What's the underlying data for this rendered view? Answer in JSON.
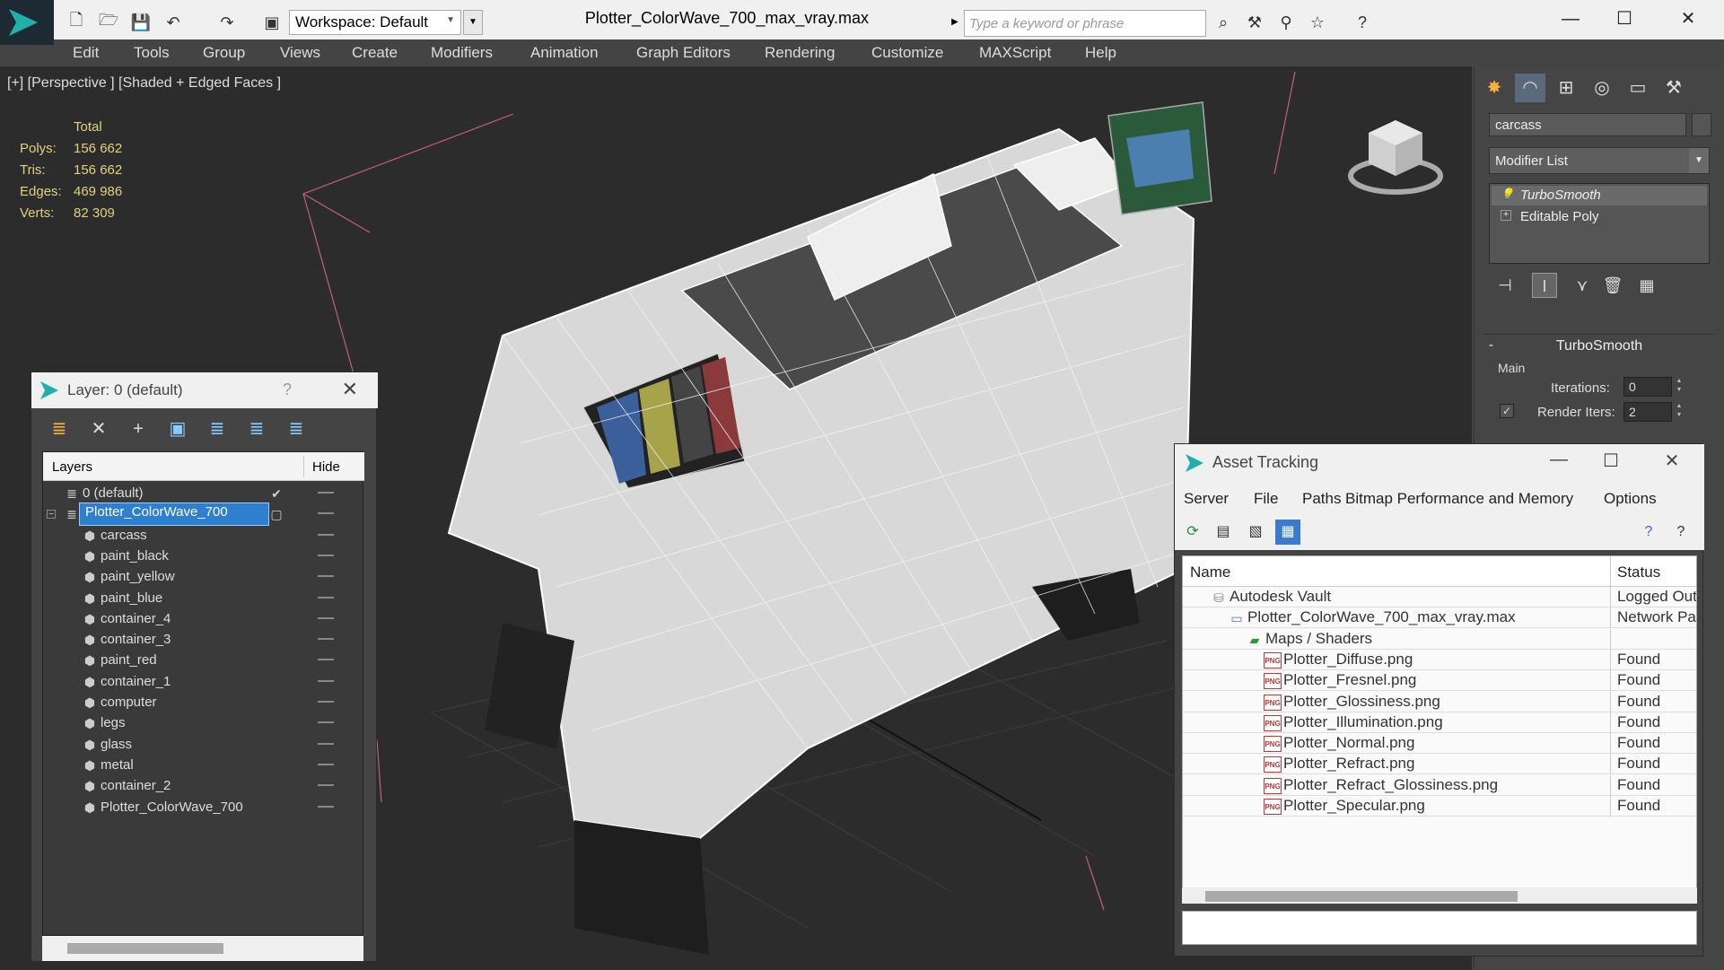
{
  "window": {
    "title": "Plotter_ColorWave_700_max_vray.max",
    "workspace_label": "Workspace: Default",
    "search_placeholder": "Type a keyword or phrase",
    "minimize": "—",
    "maximize": "☐",
    "close": "✕"
  },
  "menubar": {
    "items": [
      "Edit",
      "Tools",
      "Group",
      "Views",
      "Create",
      "Modifiers",
      "Animation",
      "Graph Editors",
      "Rendering",
      "Customize",
      "MAXScript",
      "Help"
    ]
  },
  "viewport": {
    "label": "[+] [Perspective ] [Shaded + Edged Faces ]",
    "stats": {
      "header": "Total",
      "rows": [
        {
          "label": "Polys:",
          "value": "156 662"
        },
        {
          "label": "Tris:",
          "value": "156 662"
        },
        {
          "label": "Edges:",
          "value": "469 986"
        },
        {
          "label": "Verts:",
          "value": "82 309"
        }
      ]
    }
  },
  "command_panel": {
    "object_name": "carcass",
    "modifier_list": "Modifier List",
    "stack": [
      "TurboSmooth",
      "Editable Poly"
    ],
    "rollout_title": "TurboSmooth",
    "main_label": "Main",
    "iterations_label": "Iterations:",
    "iterations_value": "0",
    "render_iters_label": "Render Iters:",
    "render_iters_value": "2",
    "render_iters_checked": true
  },
  "layer_panel": {
    "title": "Layer: 0 (default)",
    "help": "?",
    "close": "✕",
    "col_layers": "Layers",
    "col_hide": "Hide",
    "rows": [
      {
        "name": "0 (default)",
        "level": 0,
        "type": "layer",
        "checked": true,
        "selected": false
      },
      {
        "name": "Plotter_ColorWave_700",
        "level": 0,
        "type": "layer",
        "checked": false,
        "selected": true
      },
      {
        "name": "carcass",
        "level": 1,
        "type": "object",
        "selected": false
      },
      {
        "name": "paint_black",
        "level": 1,
        "type": "object",
        "selected": false
      },
      {
        "name": "paint_yellow",
        "level": 1,
        "type": "object",
        "selected": false
      },
      {
        "name": "paint_blue",
        "level": 1,
        "type": "object",
        "selected": false
      },
      {
        "name": "container_4",
        "level": 1,
        "type": "object",
        "selected": false
      },
      {
        "name": "container_3",
        "level": 1,
        "type": "object",
        "selected": false
      },
      {
        "name": "paint_red",
        "level": 1,
        "type": "object",
        "selected": false
      },
      {
        "name": "container_1",
        "level": 1,
        "type": "object",
        "selected": false
      },
      {
        "name": "computer",
        "level": 1,
        "type": "object",
        "selected": false
      },
      {
        "name": "legs",
        "level": 1,
        "type": "object",
        "selected": false
      },
      {
        "name": "glass",
        "level": 1,
        "type": "object",
        "selected": false
      },
      {
        "name": "metal",
        "level": 1,
        "type": "object",
        "selected": false
      },
      {
        "name": "container_2",
        "level": 1,
        "type": "object",
        "selected": false
      },
      {
        "name": "Plotter_ColorWave_700",
        "level": 1,
        "type": "object",
        "selected": false
      }
    ]
  },
  "asset_tracking": {
    "title": "Asset Tracking",
    "menus": [
      "Server",
      "File",
      "Paths",
      "Bitmap Performance and Memory",
      "Options"
    ],
    "col_name": "Name",
    "col_status": "Status",
    "rows": [
      {
        "name": "Autodesk Vault",
        "status": "Logged Out",
        "level": 0,
        "icon": "vault-icon"
      },
      {
        "name": "Plotter_ColorWave_700_max_vray.max",
        "status": "Network Path",
        "level": 1,
        "icon": "max-file-icon"
      },
      {
        "name": "Maps / Shaders",
        "status": "",
        "level": 2,
        "icon": "maps-folder-icon"
      },
      {
        "name": "Plotter_Diffuse.png",
        "status": "Found",
        "level": 3,
        "icon": "png-icon"
      },
      {
        "name": "Plotter_Fresnel.png",
        "status": "Found",
        "level": 3,
        "icon": "png-icon"
      },
      {
        "name": "Plotter_Glossiness.png",
        "status": "Found",
        "level": 3,
        "icon": "png-icon"
      },
      {
        "name": "Plotter_Illumination.png",
        "status": "Found",
        "level": 3,
        "icon": "png-icon"
      },
      {
        "name": "Plotter_Normal.png",
        "status": "Found",
        "level": 3,
        "icon": "png-icon"
      },
      {
        "name": "Plotter_Refract.png",
        "status": "Found",
        "level": 3,
        "icon": "png-icon"
      },
      {
        "name": "Plotter_Refract_Glossiness.png",
        "status": "Found",
        "level": 3,
        "icon": "png-icon"
      },
      {
        "name": "Plotter_Specular.png",
        "status": "Found",
        "level": 3,
        "icon": "png-icon"
      }
    ]
  },
  "colors": {
    "viewport_bg": "#2c2c2c",
    "stats_text": "#e0d080",
    "selection": "#2f7fd0",
    "brand": "#20b0a8"
  }
}
